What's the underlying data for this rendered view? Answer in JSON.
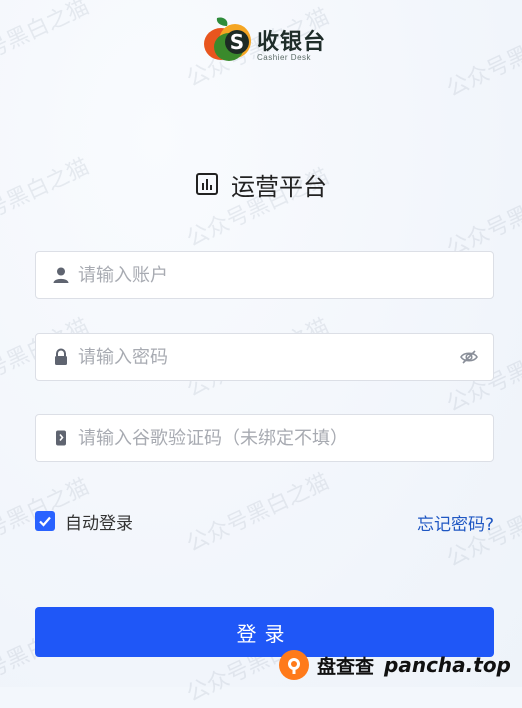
{
  "logo": {
    "text": "收银台",
    "subtext": "Cashier Desk",
    "mark_letter": "S"
  },
  "platform": {
    "title": "运营平台",
    "icon": "bar-chart-icon"
  },
  "form": {
    "account": {
      "placeholder": "请输入账户",
      "icon": "user-icon"
    },
    "password": {
      "placeholder": "请输入密码",
      "icon": "lock-icon",
      "toggle_icon": "eye-off-icon"
    },
    "google_code": {
      "placeholder": "请输入谷歌验证码（未绑定不填）",
      "icon": "key-icon"
    }
  },
  "remember": {
    "label": "自动登录",
    "checked": true
  },
  "forgot": {
    "label": "忘记密码?"
  },
  "login": {
    "label": "登录"
  },
  "watermark": {
    "text": "公众号黑白之猫"
  },
  "badge": {
    "cn": "盘查查",
    "en": "pancha.top"
  },
  "colors": {
    "primary": "#1f57f7",
    "link": "#1f57c3",
    "checkbox": "#2962ff",
    "badge_orange": "#ff7a1a"
  }
}
